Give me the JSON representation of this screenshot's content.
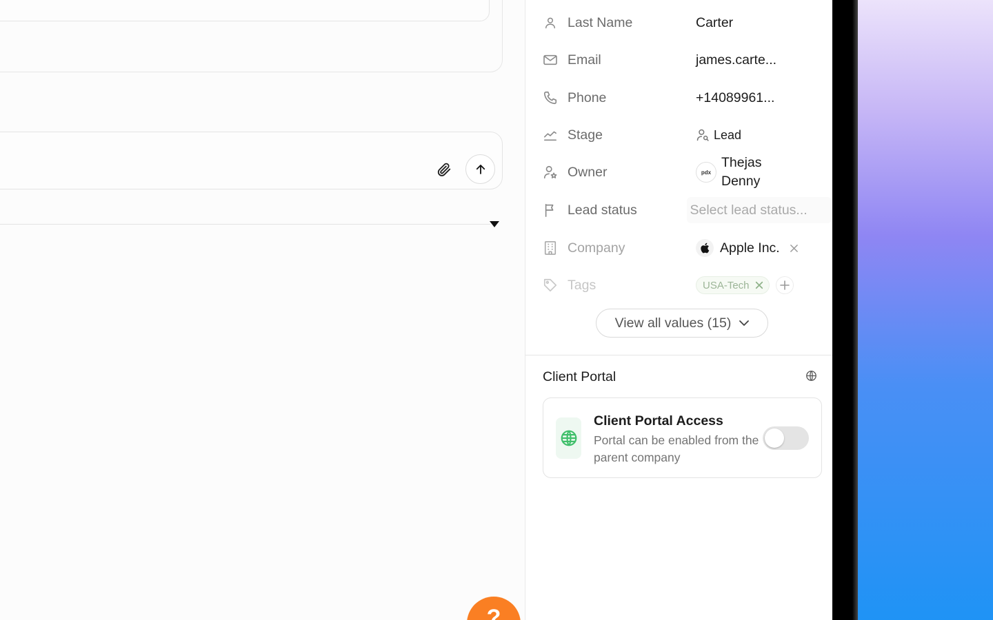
{
  "composer": {
    "attach_icon": "paperclip-icon",
    "send_icon": "arrow-up-icon"
  },
  "help": {
    "label": "?"
  },
  "contact": {
    "fields": [
      {
        "label": "Last Name",
        "value": "Carter",
        "icon": "person-icon"
      },
      {
        "label": "Email",
        "value": "james.carte...",
        "icon": "mail-icon"
      },
      {
        "label": "Phone",
        "value": "+14089961...",
        "icon": "phone-icon"
      },
      {
        "label": "Stage",
        "value": "Lead",
        "icon": "chart-line-icon"
      },
      {
        "label": "Owner",
        "value_line1": "Thejas",
        "value_line2": "Denny",
        "avatar_text": "pdx",
        "icon": "person-star-icon"
      },
      {
        "label": "Lead status",
        "placeholder": "Select lead status...",
        "icon": "flag-icon"
      },
      {
        "label": "Company",
        "value": "Apple Inc.",
        "icon": "building-icon"
      },
      {
        "label": "Tags",
        "tag": "USA-Tech",
        "icon": "tag-icon"
      }
    ],
    "view_all_label": "View all values (15)"
  },
  "client_portal": {
    "section_title": "Client Portal",
    "card_title": "Client Portal Access",
    "card_description": "Portal can be enabled from the parent company",
    "toggle_on": false
  },
  "colors": {
    "help_fab": "#fa7f23",
    "portal_icon": "#3fbf6a",
    "tag_text": "#9cb597"
  }
}
